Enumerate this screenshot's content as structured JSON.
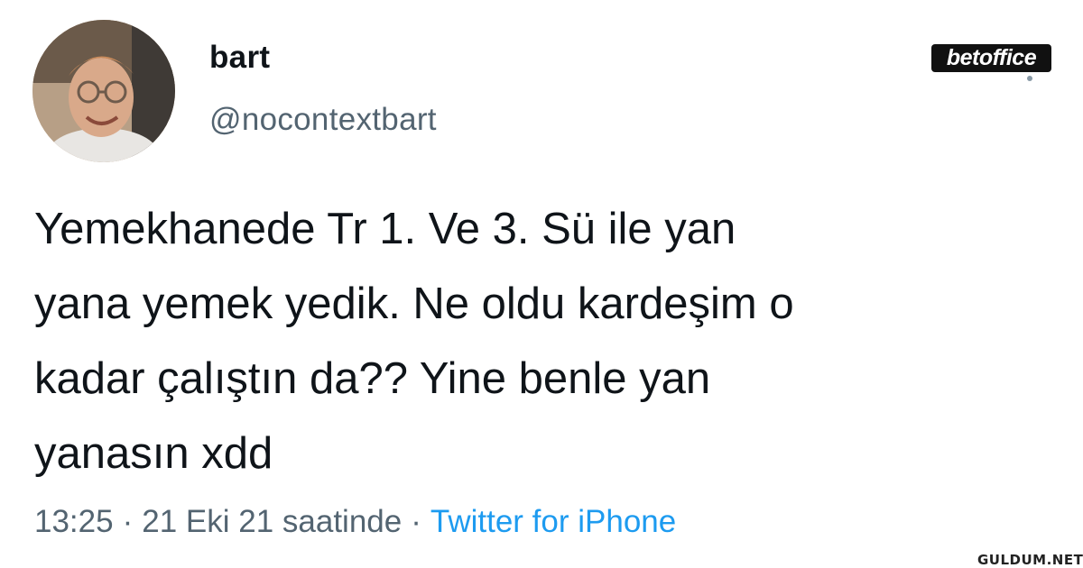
{
  "author": {
    "display_name": "bart",
    "handle": "@nocontextbart",
    "avatar": "profile-photo-avatar"
  },
  "brand": {
    "logo_text": "betoffice"
  },
  "tweet": {
    "lines": [
      "Yemekhanede Tr 1. Ve 3. Sü ile yan",
      "yana yemek yedik. Ne oldu kardeşim o",
      "kadar çalıştın da?? Yine benle yan",
      "yanasın xdd"
    ],
    "time": "13:25",
    "separator": "·",
    "date": "21 Eki 21 saatinde",
    "source": "Twitter for iPhone"
  },
  "watermark": {
    "text": "GULDUM.NET"
  },
  "colors": {
    "text_primary": "#0f1419",
    "text_secondary": "#536471",
    "link": "#1d9bf0"
  }
}
